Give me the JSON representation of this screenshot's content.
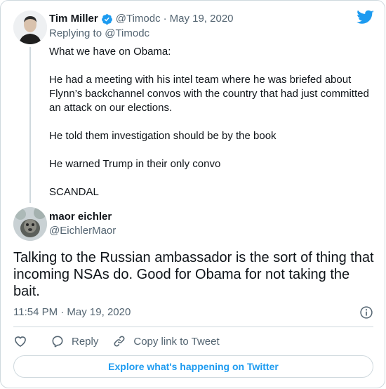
{
  "parent_tweet": {
    "author_name": "Tim Miller",
    "handle": "@Timodc",
    "separator": "·",
    "date": "May 19, 2020",
    "replying_to": "Replying to @Timodc",
    "paragraphs": [
      "What we have on Obama:",
      "He had a meeting with his intel team where he was briefed about Flynn’s backchannel convos with the country that had just committed an attack on our elections.",
      "He told them investigation should be by the book",
      "He warned Trump in their only convo",
      "SCANDAL"
    ]
  },
  "main_tweet": {
    "author_name": "maor eichler",
    "handle": "@EichlerMaor",
    "text": "Talking to the Russian ambassador is the sort of thing that incoming NSAs do. Good for Obama for not taking the bait.",
    "timestamp": "11:54 PM · May 19, 2020"
  },
  "actions": {
    "like_icon": "heart-icon",
    "reply_label": "Reply",
    "copy_link_label": "Copy link to Tweet"
  },
  "explore_button": "Explore what's happening on Twitter",
  "colors": {
    "brand_blue": "#1d9bf0",
    "secondary_text": "#536471",
    "border": "#cfd9de"
  }
}
